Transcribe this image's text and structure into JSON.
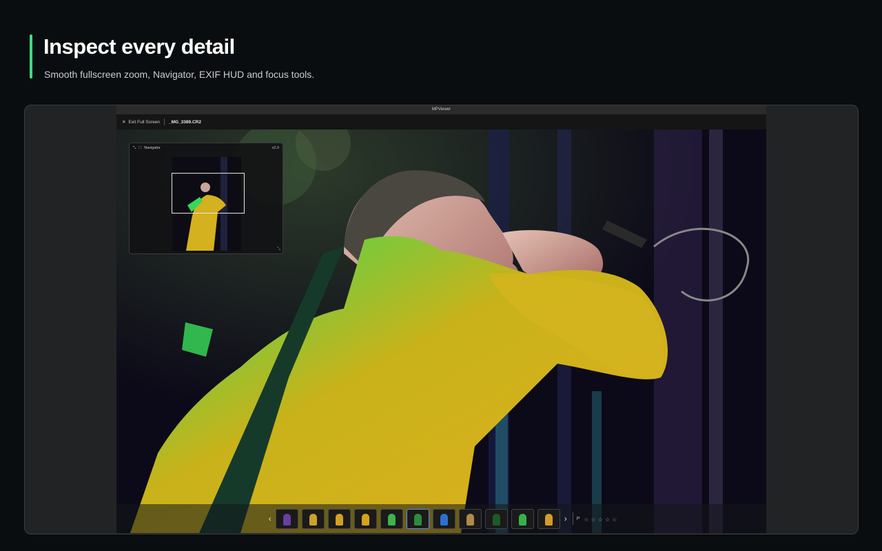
{
  "hero": {
    "title": "Inspect every detail",
    "subtitle": "Smooth fullscreen zoom, Navigator, EXIF HUD and focus tools.",
    "accent": "#3ddc84"
  },
  "window": {
    "app_title": "MPViewer",
    "exit_label": "Exit Full Screen",
    "filename": "_MG_3389.CR2"
  },
  "navigator": {
    "title": "Navigator",
    "zoom": "x2.0"
  },
  "filmstrip": {
    "prev_icon": "chevron-left-icon",
    "next_icon": "chevron-right-icon",
    "thumbs": [
      {
        "color": "#6b3fa0"
      },
      {
        "color": "#caa22a"
      },
      {
        "color": "#d1a11f"
      },
      {
        "color": "#d6a31c"
      },
      {
        "color": "#3fb24a"
      },
      {
        "color": "#2f8a3a"
      },
      {
        "color": "#2d6fd0"
      },
      {
        "color": "#b08a4a"
      },
      {
        "color": "#1f5a26"
      },
      {
        "color": "#38b04a"
      },
      {
        "color": "#d49a2a"
      }
    ],
    "selected_index": 5,
    "flag_label": "P",
    "stars": [
      "☆",
      "☆",
      "☆",
      "☆",
      "☆"
    ]
  }
}
